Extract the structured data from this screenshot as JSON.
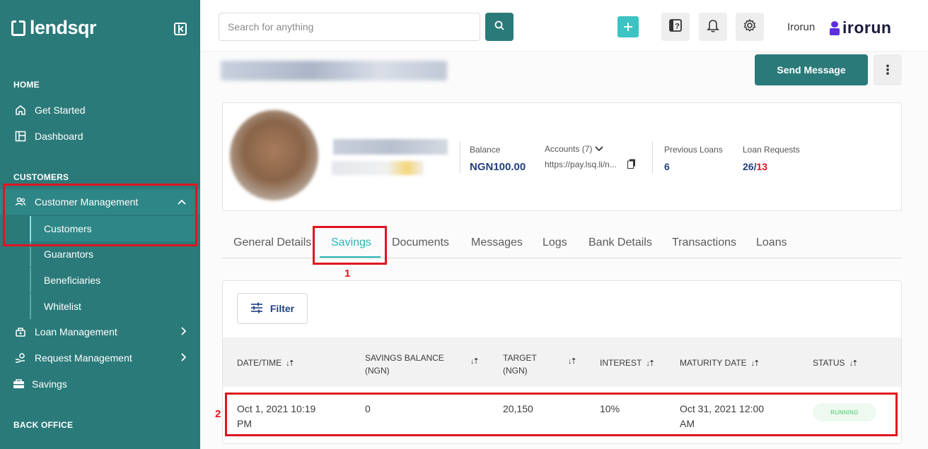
{
  "sidebar": {
    "logo_text": "lendsqr",
    "sections": {
      "home": "HOME",
      "customers": "CUSTOMERS",
      "back_office": "BACK OFFICE"
    },
    "items": {
      "get_started": "Get Started",
      "dashboard": "Dashboard",
      "customer_management": "Customer Management",
      "customers": "Customers",
      "guarantors": "Guarantors",
      "beneficiaries": "Beneficiaries",
      "whitelist": "Whitelist",
      "loan_management": "Loan Management",
      "request_management": "Request Management",
      "savings": "Savings"
    }
  },
  "header": {
    "search_placeholder": "Search for anything",
    "user_name": "Irorun",
    "brand_text": "irorun"
  },
  "actions": {
    "send_message": "Send Message",
    "more": "⋮"
  },
  "profile": {
    "balance_label": "Balance",
    "balance_value": "NGN100.00",
    "accounts_label": "Accounts (7)",
    "accounts_link": "https://pay.lsq.li/n...",
    "previous_loans_label": "Previous Loans",
    "previous_loans_value": "6",
    "loan_requests_label": "Loan Requests",
    "loan_requests_value": "26/",
    "loan_requests_red": "13"
  },
  "tabs": [
    "General Details",
    "Savings",
    "Documents",
    "Messages",
    "Logs",
    "Bank Details",
    "Transactions",
    "Loans"
  ],
  "annotations": {
    "one": "1",
    "two": "2"
  },
  "savings": {
    "filter_label": "Filter",
    "columns": {
      "datetime": "DATE/TIME",
      "balance_line1": "SAVINGS BALANCE",
      "balance_line2": "(NGN)",
      "target_line1": "TARGET",
      "target_line2": "(NGN)",
      "interest": "INTEREST",
      "maturity": "MATURITY DATE",
      "status": "STATUS"
    },
    "row": {
      "datetime_line1": "Oct 1, 2021 10:19",
      "datetime_line2": "PM",
      "balance": "0",
      "target": "20,150",
      "interest": "10%",
      "maturity_line1": "Oct 31, 2021 12:00",
      "maturity_line2": "AM",
      "status": "RUNNING"
    }
  },
  "colors": {
    "sidebar": "#2b7a7a",
    "accent": "#2cb5b5",
    "annotation": "#e0151f",
    "status_running": "#39cd62"
  }
}
